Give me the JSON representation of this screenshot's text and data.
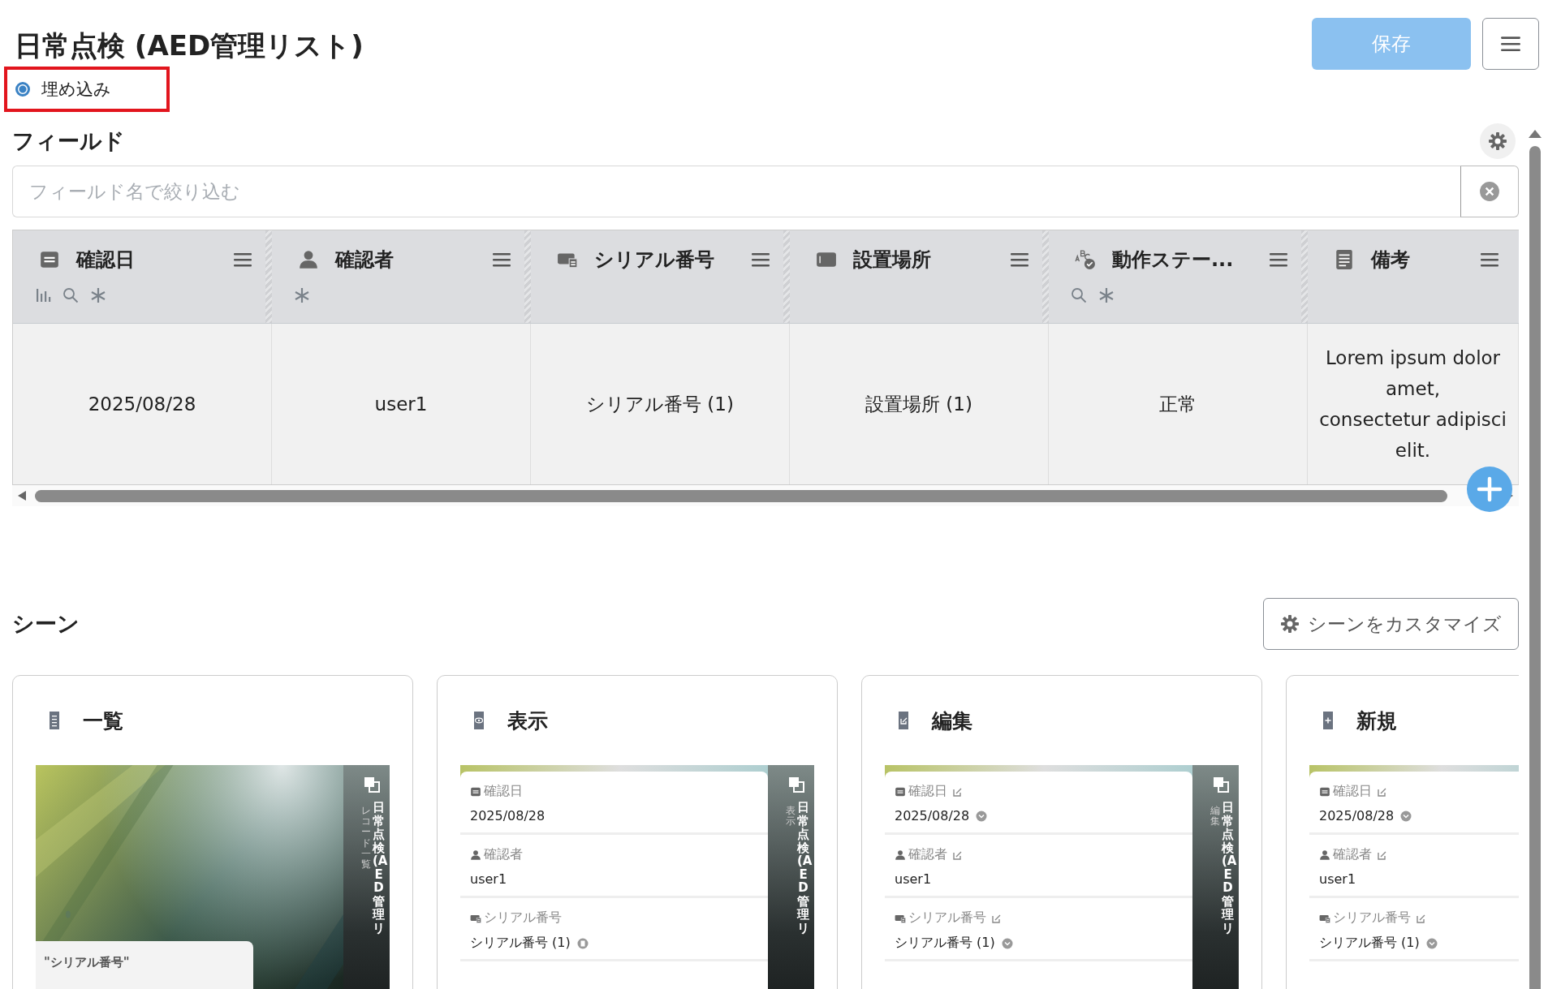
{
  "title": "日常点検 (AED管理リスト)",
  "embed": {
    "label": "埋め込み",
    "selected": true,
    "highlighted": true
  },
  "save_button": "保存",
  "fields": {
    "heading": "フィールド",
    "placeholder": "フィールド名で絞り込む",
    "columns": [
      {
        "label": "確認日",
        "kind": "date",
        "chart": true,
        "search": true,
        "star": true
      },
      {
        "label": "確認者",
        "kind": "user",
        "chart": false,
        "search": false,
        "star": true
      },
      {
        "label": "シリアル番号",
        "kind": "serial",
        "chart": false,
        "search": false,
        "star": false
      },
      {
        "label": "設置場所",
        "kind": "place",
        "chart": false,
        "search": false,
        "star": false
      },
      {
        "label": "動作ステー...",
        "kind": "status",
        "chart": false,
        "search": true,
        "star": true
      },
      {
        "label": "備考",
        "kind": "text",
        "chart": false,
        "search": false,
        "star": false
      }
    ],
    "row": [
      [
        "2025/08/28"
      ],
      [
        "user1"
      ],
      [
        "シリアル番号 (1)"
      ],
      [
        "設置場所 (1)"
      ],
      [
        "正常"
      ],
      [
        "Lorem ipsum dolor",
        "amet,",
        "consectetur adipisci",
        "elit."
      ]
    ]
  },
  "scenes": {
    "heading": "シーン",
    "customize_button": "シーンをカスタマイズ",
    "cards": [
      {
        "title": "一覧",
        "kind": "list",
        "strip": {
          "title": "日常点検 (AED管理リ",
          "subtitle": "レコード一覧"
        },
        "card_text": "\"シリアル番号\""
      },
      {
        "title": "表示",
        "kind": "view",
        "strip": {
          "title": "日常点検 (AED管理リ",
          "subtitle": "表示"
        },
        "fields": [
          {
            "label": "確認日",
            "value": "2025/08/28",
            "kind": "date",
            "editable": false,
            "value_icon": false
          },
          {
            "label": "確認者",
            "value": "user1",
            "kind": "user",
            "editable": false,
            "value_icon": false
          },
          {
            "label": "シリアル番号",
            "value": "シリアル番号 (1)",
            "kind": "serial",
            "editable": false,
            "value_icon": true
          }
        ]
      },
      {
        "title": "編集",
        "kind": "edit",
        "strip": {
          "title": "日常点検 (AED管理リ",
          "subtitle": "編集"
        },
        "fields": [
          {
            "label": "確認日",
            "value": "2025/08/28",
            "kind": "date",
            "editable": true,
            "value_icon": true
          },
          {
            "label": "確認者",
            "value": "user1",
            "kind": "user",
            "editable": true,
            "value_icon": false
          },
          {
            "label": "シリアル番号",
            "value": "シリアル番号 (1)",
            "kind": "serial",
            "editable": true,
            "value_icon": true
          }
        ]
      },
      {
        "title": "新規",
        "kind": "new",
        "fields": [
          {
            "label": "確認日",
            "value": "2025/08/28",
            "kind": "date",
            "editable": true,
            "value_icon": true
          },
          {
            "label": "確認者",
            "value": "user1",
            "kind": "user",
            "editable": true,
            "value_icon": false
          },
          {
            "label": "シリアル番号",
            "value": "シリアル番号 (1)",
            "kind": "serial",
            "editable": true,
            "value_icon": true
          }
        ]
      }
    ]
  }
}
